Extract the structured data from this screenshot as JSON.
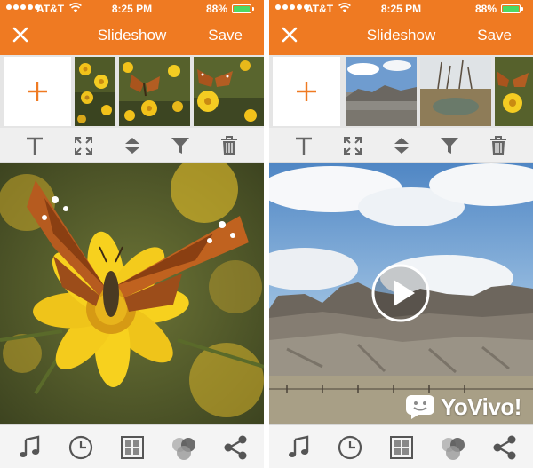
{
  "status_bar": {
    "carrier": "AT&T",
    "time": "8:25 PM",
    "battery_pct": "88%",
    "battery_level": 0.88
  },
  "nav": {
    "title": "Slideshow",
    "save_label": "Save",
    "close_icon": "close-icon"
  },
  "toolbar_icons": [
    "text-icon",
    "crop-icon",
    "reorder-icon",
    "filter-icon",
    "trash-icon"
  ],
  "tab_icons": [
    "music-icon",
    "clock-icon",
    "layout-icon",
    "effects-icon",
    "share-icon"
  ],
  "watermark": {
    "brand": "YoVivo!"
  },
  "colors": {
    "accent": "#ef7a22",
    "battery": "#4cd964",
    "toolbar_icon": "#666666",
    "tab_icon": "#555555"
  }
}
